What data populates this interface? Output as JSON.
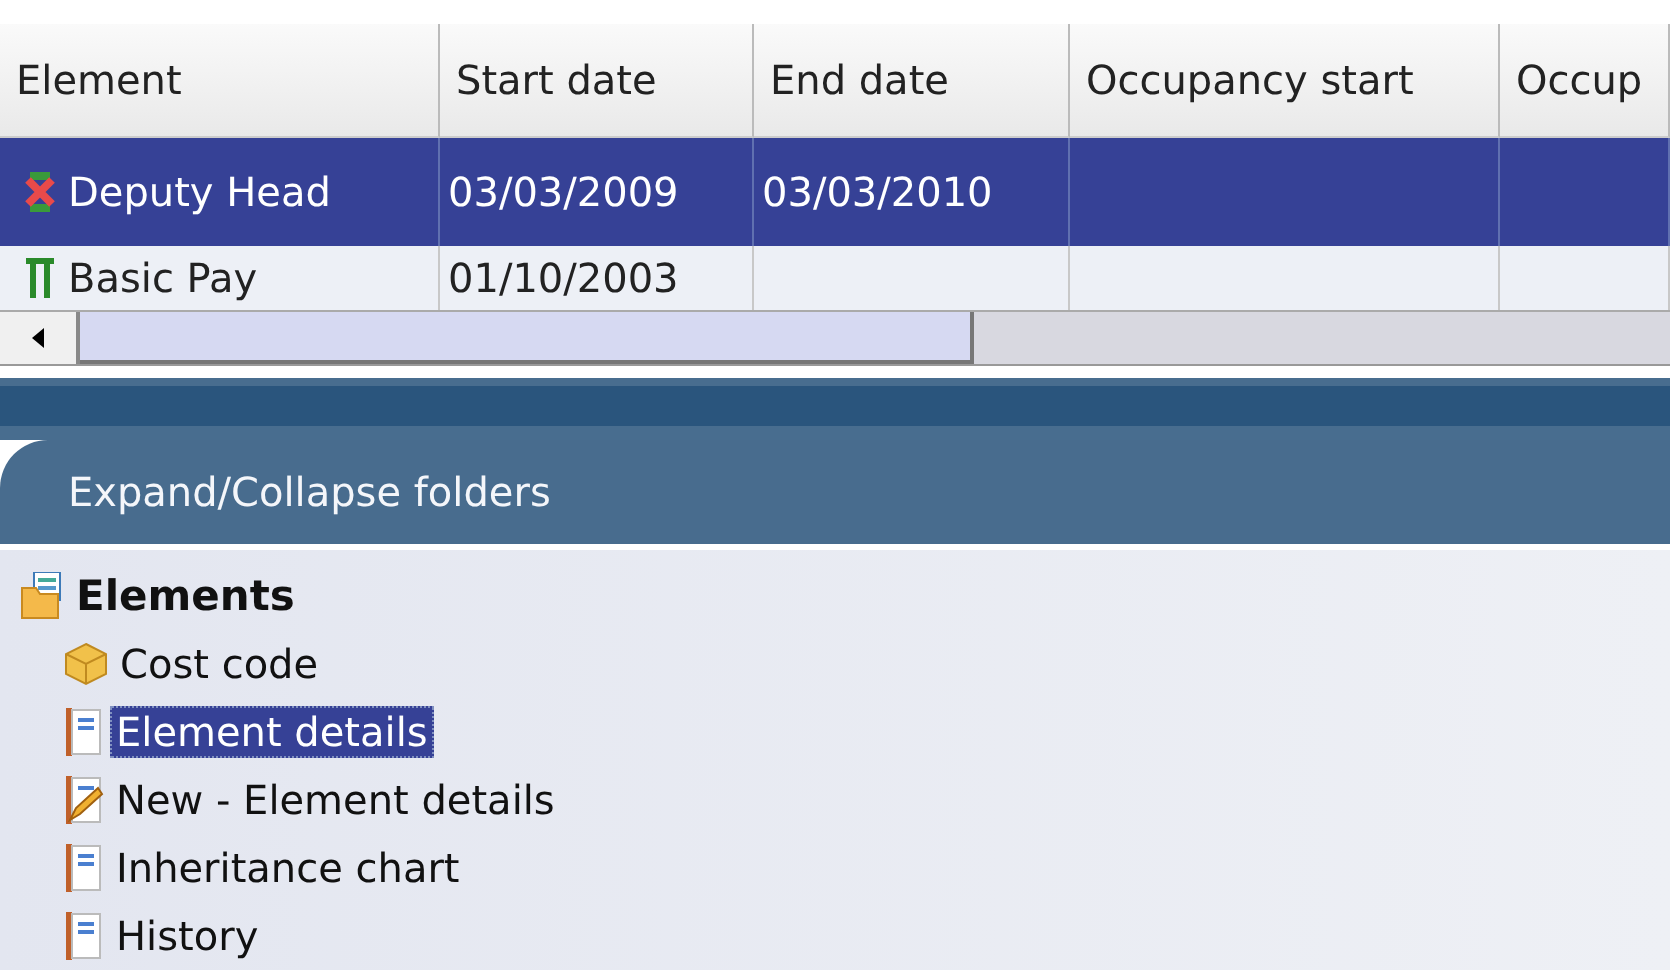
{
  "table": {
    "columns": [
      "Element",
      "Start date",
      "End date",
      "Occupancy start",
      "Occup"
    ],
    "rows": [
      {
        "kind": "deputy",
        "selected": true,
        "cells": [
          "Deputy Head",
          "03/03/2009",
          "03/03/2010",
          "",
          ""
        ]
      },
      {
        "kind": "pay",
        "selected": false,
        "cells": [
          "Basic Pay",
          "01/10/2003",
          "",
          "",
          ""
        ]
      }
    ]
  },
  "panel": {
    "title": "Expand/Collapse folders"
  },
  "tree": [
    {
      "label": "Elements",
      "kind": "folder",
      "selected": false,
      "children": [
        {
          "label": "Cost code",
          "kind": "box",
          "selected": false
        },
        {
          "label": "Element details",
          "kind": "doc",
          "selected": true
        },
        {
          "label": "New - Element details",
          "kind": "edit",
          "selected": false
        },
        {
          "label": "Inheritance chart",
          "kind": "doc",
          "selected": false
        },
        {
          "label": "History",
          "kind": "doc",
          "selected": false
        }
      ]
    }
  ]
}
